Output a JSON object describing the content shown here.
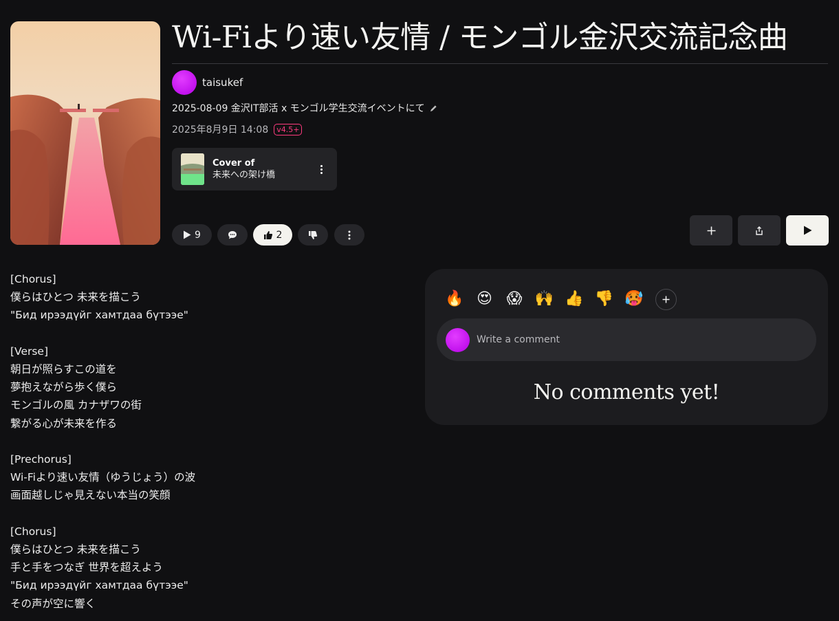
{
  "song": {
    "title": "Wi-Fiより速い友情 / モンゴル金沢交流記念曲",
    "artist": "taisukef",
    "description": "2025-08-09 金沢IT部活 x モンゴル学生交流イベントにて",
    "datetime": "2025年8月9日 14:08",
    "version": "v4.5+"
  },
  "cover_of": {
    "label": "Cover of",
    "song": "未来への架け橋"
  },
  "stats": {
    "plays": "9",
    "likes": "2"
  },
  "icons": {
    "play": "play-icon",
    "comment": "comment-bubble-icon",
    "like": "thumbs-up-icon",
    "dislike": "thumbs-down-icon",
    "more": "more-vertical-icon",
    "add": "plus-icon",
    "share": "share-icon",
    "edit": "pencil-icon"
  },
  "lyrics": "[Chorus]\n僕らはひとつ 未来を描こう\n\"Бид ирээдүйг хамтдаа бүтээе\"\n\n[Verse]\n朝日が照らすこの道を\n夢抱えながら歩く僕ら\nモンゴルの風 カナザワの街\n繋がる心が未来を作る\n\n[Prechorus]\nWi-Fiより速い友情（ゆうじょう）の波\n画面越しじゃ見えない本当の笑顔\n\n[Chorus]\n僕らはひとつ 未来を描こう\n手と手をつなぎ 世界を超えよう\n\"Бид ирээдүйг хамтдаа бүтээе\"\nその声が空に響く",
  "comments": {
    "reactions": [
      "🔥",
      "😍",
      "😱",
      "🙌",
      "👍",
      "👎",
      "🥵"
    ],
    "placeholder": "Write a comment",
    "empty_text": "No comments yet!"
  },
  "colors": {
    "background": "#101012",
    "panel": "#1c1c1f",
    "accent_badge": "#ff3b7f",
    "avatar": "#c800ff"
  }
}
